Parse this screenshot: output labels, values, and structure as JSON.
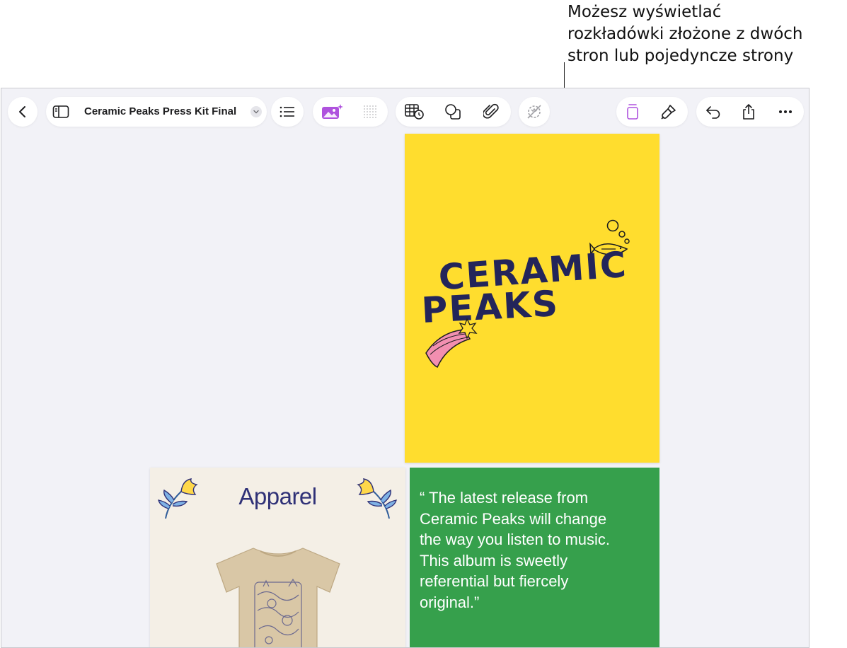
{
  "callout": {
    "lines": [
      "Możesz wyświetlać",
      "rozkładówki złożone z dwóch",
      "stron lub pojedyncze strony"
    ]
  },
  "toolbar": {
    "document_title": "Ceramic Peaks Press Kit Final",
    "accent_color": "#af52de"
  },
  "icons": {
    "back": "chevron-left-icon",
    "sidebar": "sidebar-icon",
    "title_menu": "chevron-down-icon",
    "list": "list-icon",
    "image_playground": "image-sparkle-icon",
    "grid": "dot-grid-icon",
    "table": "table-clock-icon",
    "shape": "shape-icon",
    "attach": "paperclip-icon",
    "remove": "strikethrough-sparkle-icon",
    "page_view": "page-view-icon",
    "format": "paintbrush-icon",
    "undo": "undo-icon",
    "share": "share-icon",
    "more": "more-icon"
  },
  "pages": {
    "cover": {
      "line1": "CERAMIC",
      "line2": "PEAKS",
      "background": "#ffdd2e",
      "ink": "#23255a"
    },
    "apparel": {
      "title": "Apparel",
      "background": "#f4efe6"
    },
    "quote": {
      "lines": [
        "“ The latest release from",
        "Ceramic Peaks will change",
        "the way you listen to music.",
        "This album is sweetly",
        "referential but fiercely",
        "original.”"
      ],
      "background": "#36a04c"
    }
  }
}
